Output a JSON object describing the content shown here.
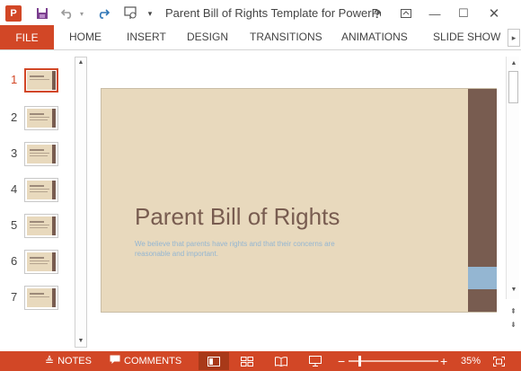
{
  "app": {
    "logo_letter": "P",
    "title": "Parent Bill of Rights Template for PowerPoi...",
    "window_buttons": {
      "help": "?",
      "ribbon_options": "⧉",
      "minimize": "—",
      "maximize": "☐",
      "close": "✕"
    },
    "quick_access": {
      "save_icon": "💾",
      "undo_icon": "↶",
      "undo_dropdown": "▾",
      "redo_icon": "↷",
      "present_icon": "⊚",
      "customize": "▾"
    }
  },
  "ribbon": {
    "file_label": "FILE",
    "tabs": [
      "HOME",
      "INSERT",
      "DESIGN",
      "TRANSITIONS",
      "ANIMATIONS",
      "SLIDE SHOW"
    ],
    "scroll_icon": "▸"
  },
  "thumbnails": {
    "items": [
      {
        "number": "1",
        "active": true
      },
      {
        "number": "2",
        "active": false
      },
      {
        "number": "3",
        "active": false
      },
      {
        "number": "4",
        "active": false
      },
      {
        "number": "5",
        "active": false
      },
      {
        "number": "6",
        "active": false
      },
      {
        "number": "7",
        "active": false
      }
    ],
    "scroll_up": "▲",
    "scroll_down": "▼"
  },
  "slide": {
    "title": "Parent Bill of Rights",
    "subtitle": "We believe that parents have rights and that their concerns are reasonable and important.",
    "colors": {
      "background": "#e8d9bd",
      "band": "#785c50",
      "accent": "#94b6d2",
      "title": "#785c50"
    }
  },
  "editor_scroll": {
    "up": "▲",
    "down": "▼",
    "prev_slide": "⇞",
    "next_slide": "⇟"
  },
  "statusbar": {
    "notes_label": "NOTES",
    "notes_icon": "≜",
    "comments_label": "COMMENTS",
    "comments_icon": "▬",
    "views": {
      "normal": "▣",
      "sorter": "⊞",
      "reading": "📖",
      "slideshow": "⊡"
    },
    "zoom_minus": "−",
    "zoom_plus": "+",
    "zoom_level": "35%",
    "zoom_fraction": 0.35,
    "fit_icon": "⛶",
    "accent_color": "#d24726"
  }
}
